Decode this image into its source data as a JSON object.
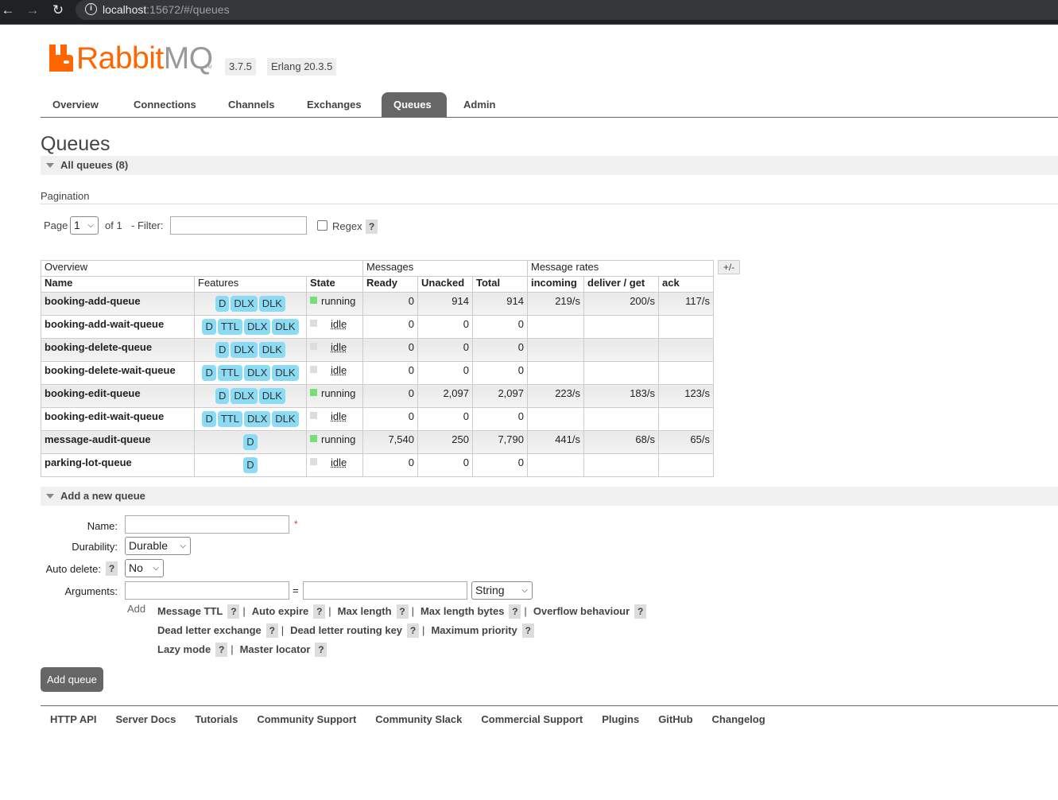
{
  "browser": {
    "url_host": "localhost",
    "url_rest": ":15672/#/queues"
  },
  "brand": {
    "logo_text_a": "Rabbit",
    "logo_text_b": "MQ",
    "tm": "TM",
    "version": "3.7.5",
    "erlang": "Erlang 20.3.5",
    "colors": {
      "orange": "#ff6600",
      "grey": "#999999",
      "running": "#77dd77",
      "idle": "#dddddd"
    }
  },
  "tabs": [
    {
      "label": "Overview",
      "active": false
    },
    {
      "label": "Connections",
      "active": false
    },
    {
      "label": "Channels",
      "active": false
    },
    {
      "label": "Exchanges",
      "active": false
    },
    {
      "label": "Queues",
      "active": true
    },
    {
      "label": "Admin",
      "active": false
    }
  ],
  "page_title": "Queues",
  "all_queues_header": "All queues (8)",
  "pagination": {
    "label": "Pagination",
    "page_label": "Page",
    "page_value": "1",
    "of_label": "of 1",
    "filter_label": "- Filter:",
    "filter_value": "",
    "regex_label": "Regex",
    "help": "?"
  },
  "table": {
    "group_headers": [
      "Overview",
      "Messages",
      "Message rates"
    ],
    "columns": [
      "Name",
      "Features",
      "State",
      "Ready",
      "Unacked",
      "Total",
      "incoming",
      "deliver / get",
      "ack"
    ],
    "toggle": "+/-",
    "rows": [
      {
        "name": "booking-add-queue",
        "features": [
          "D",
          "DLX",
          "DLK"
        ],
        "state": "running",
        "ready": "0",
        "unacked": "914",
        "total": "914",
        "incoming": "219/s",
        "deliver": "200/s",
        "ack": "117/s"
      },
      {
        "name": "booking-add-wait-queue",
        "features": [
          "D",
          "TTL",
          "DLX",
          "DLK"
        ],
        "state": "idle",
        "ready": "0",
        "unacked": "0",
        "total": "0",
        "incoming": "",
        "deliver": "",
        "ack": ""
      },
      {
        "name": "booking-delete-queue",
        "features": [
          "D",
          "DLX",
          "DLK"
        ],
        "state": "idle",
        "ready": "0",
        "unacked": "0",
        "total": "0",
        "incoming": "",
        "deliver": "",
        "ack": ""
      },
      {
        "name": "booking-delete-wait-queue",
        "features": [
          "D",
          "TTL",
          "DLX",
          "DLK"
        ],
        "state": "idle",
        "ready": "0",
        "unacked": "0",
        "total": "0",
        "incoming": "",
        "deliver": "",
        "ack": ""
      },
      {
        "name": "booking-edit-queue",
        "features": [
          "D",
          "DLX",
          "DLK"
        ],
        "state": "running",
        "ready": "0",
        "unacked": "2,097",
        "total": "2,097",
        "incoming": "223/s",
        "deliver": "183/s",
        "ack": "123/s"
      },
      {
        "name": "booking-edit-wait-queue",
        "features": [
          "D",
          "TTL",
          "DLX",
          "DLK"
        ],
        "state": "idle",
        "ready": "0",
        "unacked": "0",
        "total": "0",
        "incoming": "",
        "deliver": "",
        "ack": ""
      },
      {
        "name": "message-audit-queue",
        "features": [
          "D"
        ],
        "state": "running",
        "ready": "7,540",
        "unacked": "250",
        "total": "7,790",
        "incoming": "441/s",
        "deliver": "68/s",
        "ack": "65/s"
      },
      {
        "name": "parking-lot-queue",
        "features": [
          "D"
        ],
        "state": "idle",
        "ready": "0",
        "unacked": "0",
        "total": "0",
        "incoming": "",
        "deliver": "",
        "ack": ""
      }
    ]
  },
  "add_queue": {
    "header": "Add a new queue",
    "name_label": "Name:",
    "name_value": "",
    "required_mark": "*",
    "durability_label": "Durability:",
    "durability_value": "Durable",
    "auto_delete_label": "Auto delete:",
    "auto_delete_value": "No",
    "arguments_label": "Arguments:",
    "equals": "=",
    "arg_type": "String",
    "add_label": "Add",
    "arg_links_row1": [
      "Message TTL",
      "Auto expire",
      "Max length",
      "Max length bytes",
      "Overflow behaviour"
    ],
    "arg_links_row2": [
      "Dead letter exchange",
      "Dead letter routing key",
      "Maximum priority"
    ],
    "arg_links_row3": [
      "Lazy mode",
      "Master locator"
    ],
    "submit": "Add queue"
  },
  "footer": [
    "HTTP API",
    "Server Docs",
    "Tutorials",
    "Community Support",
    "Community Slack",
    "Commercial Support",
    "Plugins",
    "GitHub",
    "Changelog"
  ]
}
